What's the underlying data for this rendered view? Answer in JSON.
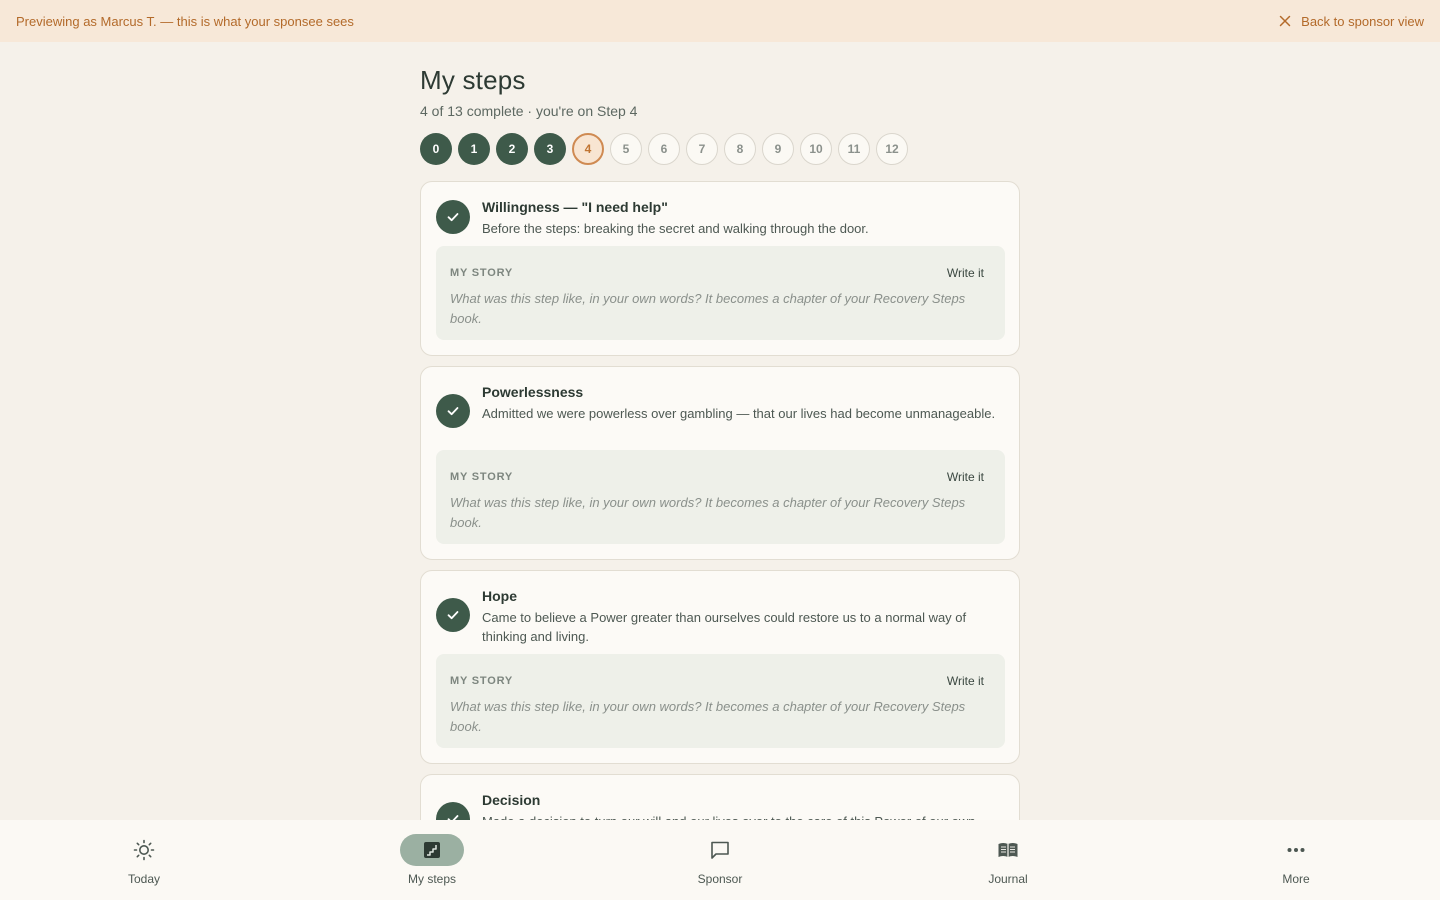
{
  "banner": {
    "message": "Previewing as Marcus T. — this is what your sponsee sees",
    "back_label": "Back to sponsor view"
  },
  "page": {
    "title": "My steps",
    "subtitle": "4 of 13 complete · you're on Step 4"
  },
  "steps": [
    {
      "label": "0",
      "state": "done"
    },
    {
      "label": "1",
      "state": "done"
    },
    {
      "label": "2",
      "state": "done"
    },
    {
      "label": "3",
      "state": "done"
    },
    {
      "label": "4",
      "state": "current"
    },
    {
      "label": "5",
      "state": "todo"
    },
    {
      "label": "6",
      "state": "todo"
    },
    {
      "label": "7",
      "state": "todo"
    },
    {
      "label": "8",
      "state": "todo"
    },
    {
      "label": "9",
      "state": "todo"
    },
    {
      "label": "10",
      "state": "todo"
    },
    {
      "label": "11",
      "state": "todo"
    },
    {
      "label": "12",
      "state": "todo"
    }
  ],
  "cards": [
    {
      "title": "Willingness — \"I need help\"",
      "description": "Before the steps: breaking the secret and walking through the door.",
      "story_label": "MY STORY",
      "story_action": "Write it",
      "story_prompt": "What was this step like, in your own words? It becomes a chapter of your Recovery Steps book."
    },
    {
      "title": "Powerlessness",
      "description": "Admitted we were powerless over gambling — that our lives had become unmanageable.",
      "story_label": "MY STORY",
      "story_action": "Write it",
      "story_prompt": "What was this step like, in your own words? It becomes a chapter of your Recovery Steps book."
    },
    {
      "title": "Hope",
      "description": "Came to believe a Power greater than ourselves could restore us to a normal way of thinking and living.",
      "story_label": "MY STORY",
      "story_action": "Write it",
      "story_prompt": "What was this step like, in your own words? It becomes a chapter of your Recovery Steps book."
    },
    {
      "title": "Decision",
      "description": "Made a decision to turn our will and our lives over to the care of this Power of our own"
    }
  ],
  "nav": [
    {
      "label": "Today",
      "icon": "sun-icon"
    },
    {
      "label": "My steps",
      "icon": "stairs-icon",
      "active": true
    },
    {
      "label": "Sponsor",
      "icon": "chat-bubble-icon"
    },
    {
      "label": "Journal",
      "icon": "book-icon"
    },
    {
      "label": "More",
      "icon": "more-dots-icon"
    }
  ],
  "colors": {
    "accent_dark_green": "#3e5a4a",
    "banner_bg": "#f7e8d8",
    "banner_text": "#b36a2a",
    "current_step_border": "#cf8a52",
    "page_bg": "#f5f1ea"
  }
}
